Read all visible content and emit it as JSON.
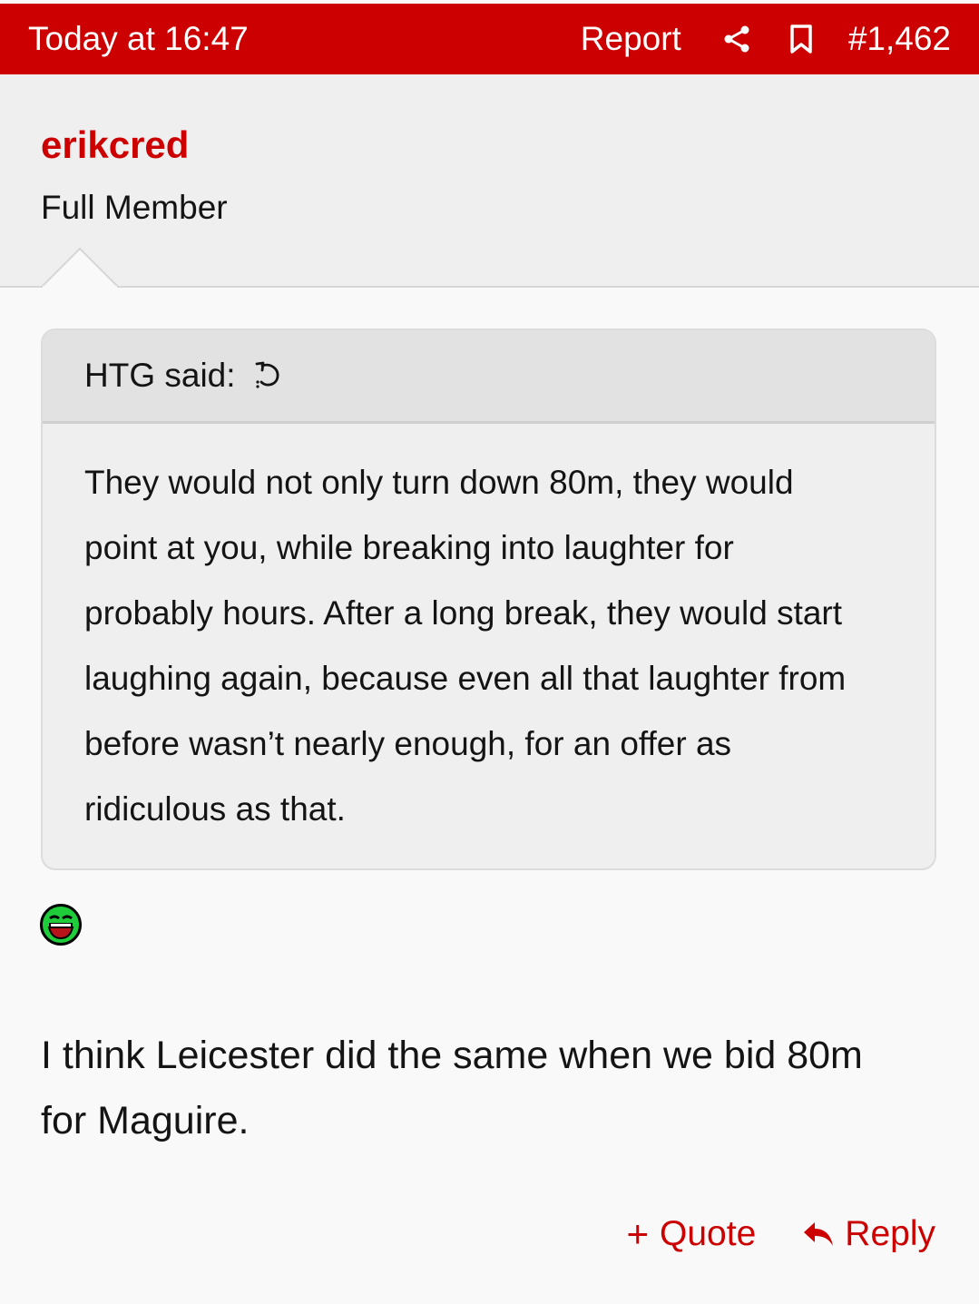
{
  "header": {
    "timestamp": "Today at 16:47",
    "report_label": "Report",
    "share_icon": "share-icon",
    "bookmark_icon": "bookmark-icon",
    "post_number": "#1,462"
  },
  "user": {
    "name": "erikcred",
    "title": "Full Member"
  },
  "quote": {
    "author_label": "HTG said:",
    "jump_icon": "jump-to-quote-icon",
    "lines": [
      "They would not only turn down 80m, they would",
      "point at you, while breaking into laughter for",
      "probably hours. After a long break, they would start",
      "laughing again, because even all that laughter from",
      "before wasn’t nearly enough, for an offer as",
      "ridiculous as that."
    ]
  },
  "emoji": "laughing-emoji",
  "message": {
    "lines": [
      "I think Leicester did the same when we bid 80m",
      "for Maguire."
    ]
  },
  "actions": {
    "quote_label": "Quote",
    "reply_label": "Reply"
  },
  "colors": {
    "accent": "#cc0000",
    "header_bg": "#cc0000",
    "userbar_bg": "#efefef",
    "quote_bg": "#efefef",
    "quote_head_bg": "#e2e2e2",
    "page_bg": "#f9f9f9"
  }
}
